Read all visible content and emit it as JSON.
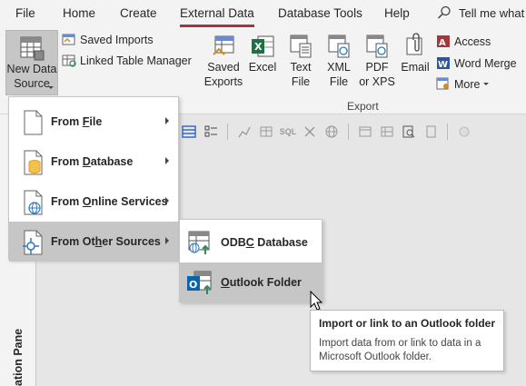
{
  "tabs": [
    {
      "label": "File"
    },
    {
      "label": "Home"
    },
    {
      "label": "Create"
    },
    {
      "label": "External Data"
    },
    {
      "label": "Database Tools"
    },
    {
      "label": "Help"
    }
  ],
  "tell_me": "Tell me what",
  "ribbon": {
    "new_data_source": "New Data\nSource",
    "saved_imports": "Saved Imports",
    "linked_table_manager": "Linked Table Manager",
    "export_buttons": [
      {
        "label": "Saved\nExports"
      },
      {
        "label": "Excel"
      },
      {
        "label": "Text\nFile"
      },
      {
        "label": "XML\nFile"
      },
      {
        "label": "PDF\nor XPS"
      },
      {
        "label": "Email"
      }
    ],
    "access": "Access",
    "word_merge": "Word Merge",
    "more": "More",
    "export_group": "Export"
  },
  "menu": {
    "items": [
      {
        "pre": "From ",
        "u": "F",
        "post": "ile"
      },
      {
        "pre": "From ",
        "u": "D",
        "post": "atabase"
      },
      {
        "pre": "From ",
        "u": "O",
        "post": "nline Services"
      },
      {
        "pre": "From Ot",
        "u": "h",
        "post": "er Sources"
      }
    ]
  },
  "submenu": {
    "items": [
      {
        "pre": "ODB",
        "u": "C",
        "post": " Database"
      },
      {
        "pre": "",
        "u": "O",
        "post": "utlook Folder"
      }
    ]
  },
  "tooltip": {
    "title": "Import or link to an Outlook folder",
    "body": "Import data from or link to data in a Microsoft Outlook folder."
  },
  "nav_pane_label": "ation Pane",
  "colors": {
    "accent": "#a4373a",
    "highlight": "#c6c6c6"
  }
}
